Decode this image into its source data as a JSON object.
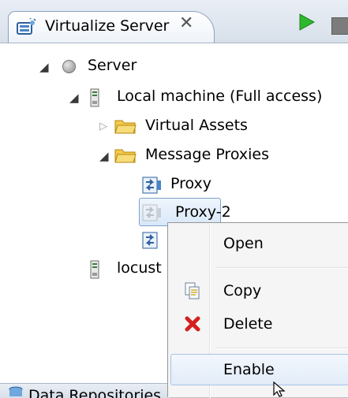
{
  "view": {
    "tab_title": "Virtualize Server",
    "tab_close": "✕",
    "toolbar": {
      "run_icon": "run-icon",
      "stop_icon": "stop-icon"
    }
  },
  "tree": {
    "server": "Server",
    "local_machine": "Local machine (Full access)",
    "virtual_assets": "Virtual Assets",
    "message_proxies": "Message Proxies",
    "proxy": "Proxy",
    "proxy2": "Proxy-2",
    "locust": "locust"
  },
  "context_menu": {
    "open": "Open",
    "copy": "Copy",
    "delete": "Delete",
    "enable": "Enable"
  },
  "bottom_tab": {
    "label": "Data Repositories"
  },
  "colors": {
    "run_green": "#2eb82e",
    "delete_red": "#d42020",
    "folder_yellow": "#f2c94c"
  }
}
